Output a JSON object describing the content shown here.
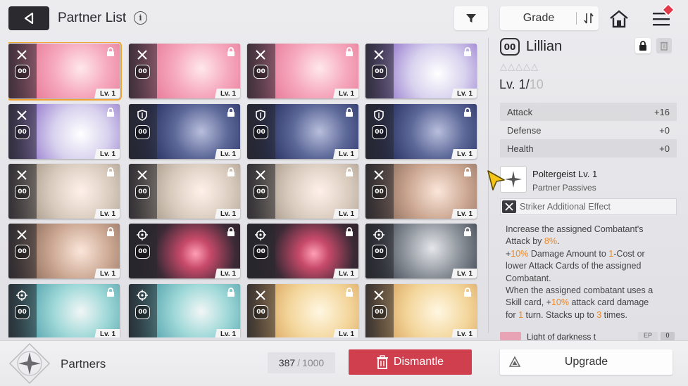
{
  "header": {
    "title": "Partner List",
    "info_icon": "i",
    "sort_label": "Grade"
  },
  "colors": {
    "accent": "#f0a531",
    "dismantle": "#cf3f4e",
    "highlight": "#e8892a"
  },
  "cards": [
    {
      "level": "Lv. 1",
      "badge": "00",
      "icon": "crossed-swords-icon",
      "art": "pink",
      "selected": true
    },
    {
      "level": "Lv. 1",
      "badge": "00",
      "icon": "crossed-swords-icon",
      "art": "pink"
    },
    {
      "level": "Lv. 1",
      "badge": "00",
      "icon": "crossed-swords-icon",
      "art": "pink"
    },
    {
      "level": "Lv. 1",
      "badge": "00",
      "icon": "crossed-swords-icon",
      "art": "purple"
    },
    {
      "level": "Lv. 1",
      "badge": "00",
      "icon": "crossed-swords-icon",
      "art": "purple"
    },
    {
      "level": "Lv. 1",
      "badge": "00",
      "icon": "shield-icon",
      "art": "navy"
    },
    {
      "level": "Lv. 1",
      "badge": "00",
      "icon": "shield-icon",
      "art": "navy"
    },
    {
      "level": "Lv. 1",
      "badge": "00",
      "icon": "shield-icon",
      "art": "navy"
    },
    {
      "level": "Lv. 1",
      "badge": "00",
      "icon": "crossed-swords-icon",
      "art": "beige"
    },
    {
      "level": "Lv. 1",
      "badge": "00",
      "icon": "crossed-swords-icon",
      "art": "beige"
    },
    {
      "level": "Lv. 1",
      "badge": "00",
      "icon": "crossed-swords-icon",
      "art": "beige"
    },
    {
      "level": "Lv. 1",
      "badge": "00",
      "icon": "crossed-swords-icon",
      "art": "brown"
    },
    {
      "level": "Lv. 1",
      "badge": "00",
      "icon": "crossed-swords-icon",
      "art": "brown"
    },
    {
      "level": "Lv. 1",
      "badge": "00",
      "icon": "target-icon",
      "art": "dark"
    },
    {
      "level": "Lv. 1",
      "badge": "00",
      "icon": "target-icon",
      "art": "dark"
    },
    {
      "level": "Lv. 1",
      "badge": "00",
      "icon": "target-icon",
      "art": "grey"
    },
    {
      "level": "Lv. 1",
      "badge": "00",
      "icon": "target-icon",
      "art": "teal"
    },
    {
      "level": "Lv. 1",
      "badge": "00",
      "icon": "target-icon",
      "art": "teal"
    },
    {
      "level": "Lv. 1",
      "badge": "00",
      "icon": "crossed-swords-icon",
      "art": "blonde"
    },
    {
      "level": "Lv. 1",
      "badge": "00",
      "icon": "crossed-swords-icon",
      "art": "blonde"
    }
  ],
  "detail": {
    "badge": "00",
    "name": "Lillian",
    "stars": "△△△△△",
    "level_prefix": "Lv. 1/",
    "level_max": "10",
    "stats": [
      {
        "label": "Attack",
        "value": "+16"
      },
      {
        "label": "Defense",
        "value": "+0"
      },
      {
        "label": "Health",
        "value": "+0"
      }
    ],
    "passive_name": "Poltergeist Lv. 1",
    "passive_type": "Partner Passives",
    "effect_label": "Striker Additional Effect",
    "desc": {
      "l1": "Increase the assigned Combatant's",
      "l2a": "Attack by ",
      "l2b": "8%",
      "l2c": ".",
      "l3a": "+",
      "l3b": "10%",
      "l3c": " Damage Amount to ",
      "l3d": "1",
      "l3e": "-Cost or",
      "l4": "lower Attack Cards of the assigned",
      "l5": "Combatant.",
      "l6": "When the assigned combatant uses a",
      "l7a": "Skill card, +",
      "l7b": "10%",
      "l7c": " attack card damage",
      "l8a": "for ",
      "l8b": "1",
      "l8c": " turn. Stacks up to ",
      "l8d": "3",
      "l8e": " times."
    },
    "next_item_text": "Light of darkness t",
    "next_item_tag": "EP",
    "next_item_count": "0"
  },
  "footer": {
    "label": "Partners",
    "count_current": "387",
    "count_sep": "/",
    "count_max": "1000",
    "dismantle_label": "Dismantle",
    "upgrade_label": "Upgrade"
  }
}
